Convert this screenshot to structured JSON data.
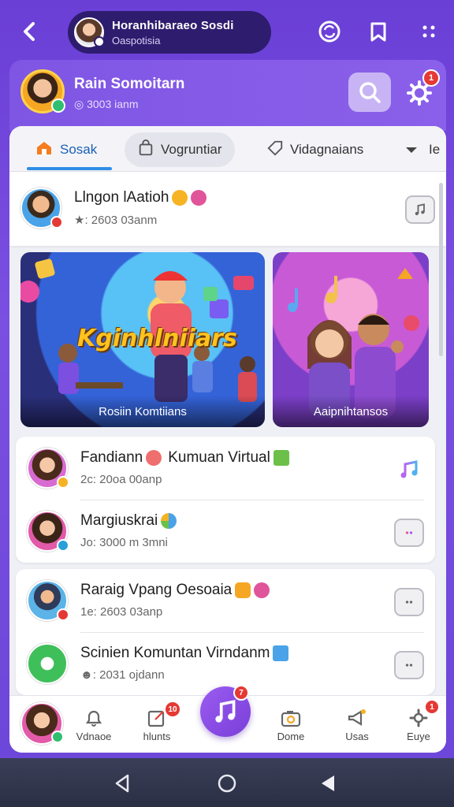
{
  "topbar": {
    "title": "Horanhibaraeo Sosdi",
    "subtitle": "Oaspotisia"
  },
  "profile": {
    "name": "Rain Somoitarn",
    "sub": "◎ 3003 ianm",
    "notif": "1"
  },
  "tabs": [
    {
      "label": "Sosak",
      "active": true
    },
    {
      "label": "Vogruntiar"
    },
    {
      "label": "Vidagnaians"
    },
    {
      "label": "Ie"
    }
  ],
  "first_row": {
    "title": "Llngon lAatioh",
    "meta": "★: 2603 03anm"
  },
  "tiles": [
    {
      "headline": "Kginhlniiars",
      "caption": "Rosiin Komtiians"
    },
    {
      "caption": "Aaipnihtansos"
    }
  ],
  "group1": [
    {
      "title": "Fandiann",
      "title2": "Kumuan Virtual",
      "meta": "2c: 20oa 00anp"
    },
    {
      "title": "Margiuskrai",
      "meta": "Jo: 3000 m 3mni"
    }
  ],
  "group2": [
    {
      "title": "Raraig Vpang Oesoaia",
      "meta": "1e: 2603 03anp"
    },
    {
      "title": "Scinien Komuntan Virndanm",
      "meta": "☻: 2031 ojdann"
    }
  ],
  "bottom_nav": [
    {
      "label": "Vdnaoe"
    },
    {
      "label": "hlunts",
      "badge": "10"
    },
    {
      "label": "",
      "badge": "7"
    },
    {
      "label": "Dome"
    },
    {
      "label": "Usas"
    },
    {
      "label": "Euye",
      "badge": "1"
    }
  ],
  "colors": {
    "accent": "#7b4fe0",
    "tab_underline": "#2f8de4",
    "badge": "#e53935"
  }
}
